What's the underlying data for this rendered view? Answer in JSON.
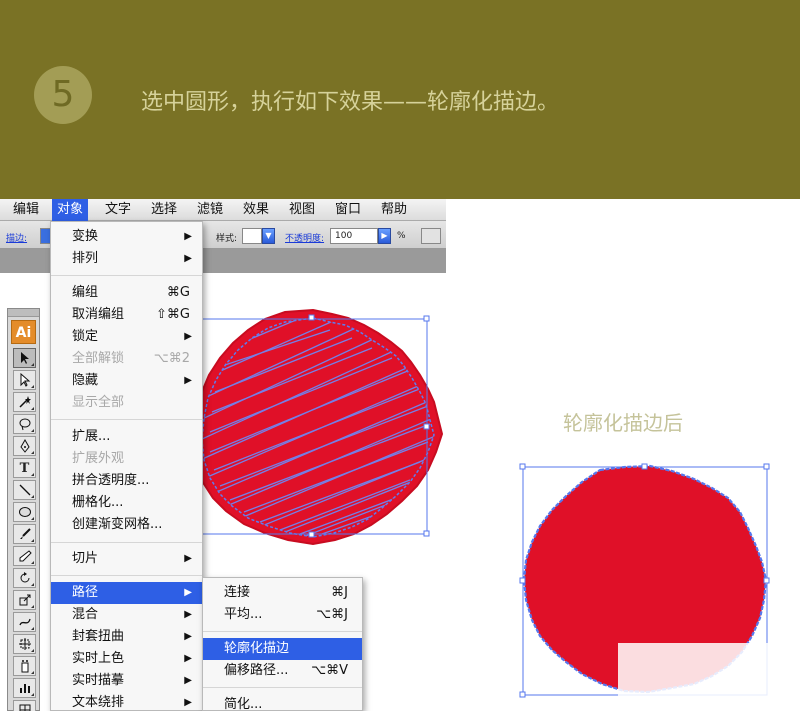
{
  "banner": {
    "step_number": "5",
    "instruction": "选中圆形，执行如下效果——轮廓化描边。"
  },
  "menubar": {
    "items": [
      "编辑",
      "对象",
      "文字",
      "选择",
      "滤镜",
      "效果",
      "视图",
      "窗口",
      "帮助"
    ],
    "active_item": "对象"
  },
  "controlbar": {
    "stroke_label": "描边:",
    "style_label": "样式:",
    "opacity_label": "不透明度:",
    "opacity_value": "100",
    "percent": "%"
  },
  "tools": {
    "logo": "Ai",
    "icons": [
      "selection-tool-icon",
      "direct-selection-tool-icon",
      "magic-wand-icon",
      "lasso-icon",
      "pen-tool-icon",
      "type-tool-icon",
      "line-tool-icon",
      "ellipse-tool-icon",
      "paintbrush-icon",
      "pencil-icon",
      "rotate-tool-icon",
      "scale-tool-icon",
      "warp-tool-icon",
      "free-transform-icon",
      "symbol-sprayer-icon",
      "graph-tool-icon",
      "mesh-tool-icon"
    ]
  },
  "object_menu": {
    "items": [
      {
        "label": "变换",
        "shortcut": "",
        "submenu": true,
        "disabled": false
      },
      {
        "label": "排列",
        "shortcut": "",
        "submenu": true,
        "disabled": false
      },
      {
        "label": "编组",
        "shortcut": "⌘G",
        "submenu": false,
        "disabled": false
      },
      {
        "label": "取消编组",
        "shortcut": "⇧⌘G",
        "submenu": false,
        "disabled": false
      },
      {
        "label": "锁定",
        "shortcut": "",
        "submenu": true,
        "disabled": false
      },
      {
        "label": "全部解锁",
        "shortcut": "⌥⌘2",
        "submenu": false,
        "disabled": true
      },
      {
        "label": "隐藏",
        "shortcut": "",
        "submenu": true,
        "disabled": false
      },
      {
        "label": "显示全部",
        "shortcut": "",
        "submenu": false,
        "disabled": true
      },
      {
        "label": "扩展...",
        "shortcut": "",
        "submenu": false,
        "disabled": false
      },
      {
        "label": "扩展外观",
        "shortcut": "",
        "submenu": false,
        "disabled": true
      },
      {
        "label": "拼合透明度...",
        "shortcut": "",
        "submenu": false,
        "disabled": false
      },
      {
        "label": "栅格化...",
        "shortcut": "",
        "submenu": false,
        "disabled": false
      },
      {
        "label": "创建渐变网格...",
        "shortcut": "",
        "submenu": false,
        "disabled": false
      },
      {
        "label": "切片",
        "shortcut": "",
        "submenu": true,
        "disabled": false
      },
      {
        "label": "路径",
        "shortcut": "",
        "submenu": true,
        "disabled": false,
        "highlighted": true
      },
      {
        "label": "混合",
        "shortcut": "",
        "submenu": true,
        "disabled": false
      },
      {
        "label": "封套扭曲",
        "shortcut": "",
        "submenu": true,
        "disabled": false
      },
      {
        "label": "实时上色",
        "shortcut": "",
        "submenu": true,
        "disabled": false
      },
      {
        "label": "实时描摹",
        "shortcut": "",
        "submenu": true,
        "disabled": false
      },
      {
        "label": "文本绕排",
        "shortcut": "",
        "submenu": true,
        "disabled": false
      }
    ]
  },
  "path_submenu": {
    "items": [
      {
        "label": "连接",
        "shortcut": "⌘J"
      },
      {
        "label": "平均...",
        "shortcut": "⌥⌘J"
      },
      {
        "label": "轮廓化描边",
        "shortcut": "",
        "highlighted": true
      },
      {
        "label": "偏移路径...",
        "shortcut": "⌥⌘V"
      },
      {
        "label": "简化...",
        "shortcut": ""
      }
    ]
  },
  "after_label": "轮廓化描边后",
  "colors": {
    "banner_bg": "#7a7225",
    "banner_text": "#d6d29a",
    "menu_highlight": "#2e5fe5",
    "shape_fill": "#e01028",
    "path_blue": "#5577ee"
  }
}
